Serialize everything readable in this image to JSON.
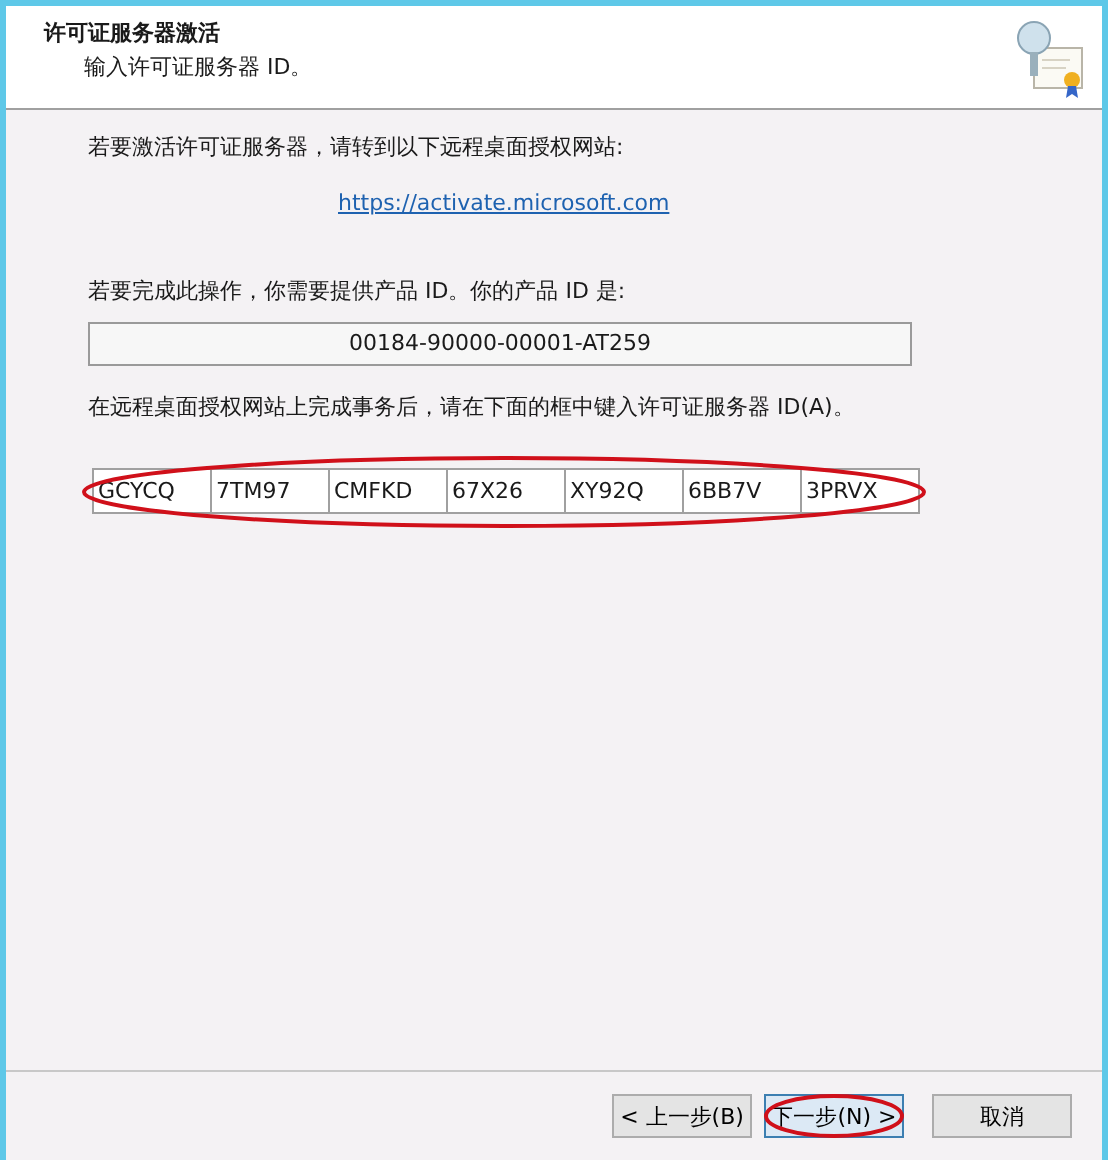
{
  "header": {
    "title": "许可证服务器激活",
    "subtitle": "输入许可证服务器 ID。"
  },
  "body": {
    "intro": "若要激活许可证服务器，请转到以下远程桌面授权网站:",
    "link": "https://activate.microsoft.com",
    "product_prompt": "若要完成此操作，你需要提供产品 ID。你的产品 ID 是:",
    "product_id": "00184-90000-00001-AT259",
    "entry_prompt": "在远程桌面授权网站上完成事务后，请在下面的框中键入许可证服务器 ID(A)。",
    "server_id_fields": [
      "GCYCQ",
      "7TM97",
      "CMFKD",
      "67X26",
      "XY92Q",
      "6BB7V",
      "3PRVX"
    ]
  },
  "buttons": [
    {
      "label": "< 上一步(B)",
      "selected": false
    },
    {
      "label": "下一步(N) >",
      "selected": true
    },
    {
      "label": "取消",
      "selected": false
    }
  ]
}
